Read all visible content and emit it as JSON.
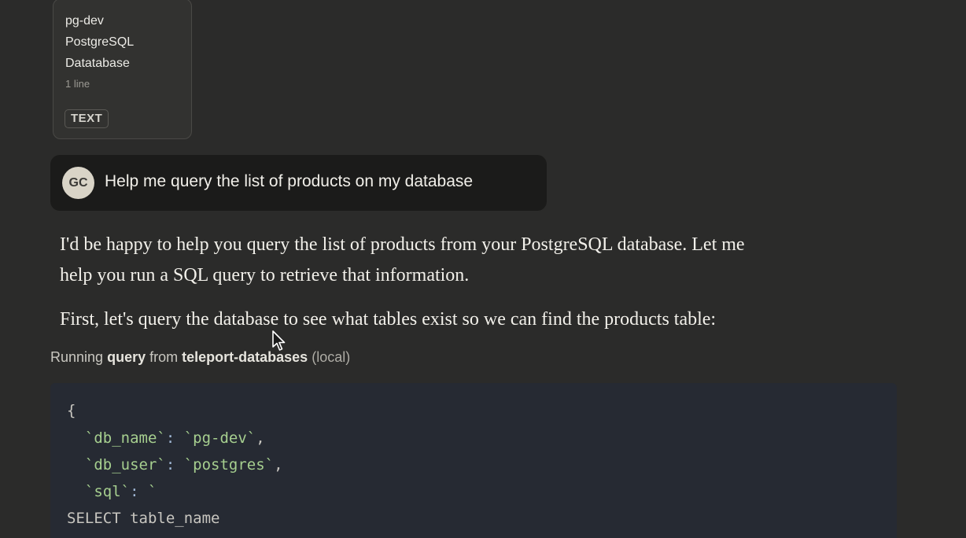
{
  "attachment": {
    "title_lines": [
      "pg-dev",
      "PostgreSQL",
      "Datatabase"
    ],
    "meta": "1 line",
    "badge": "TEXT"
  },
  "user_message": {
    "avatar_initials": "GC",
    "text": "Help me query the list of products on my database"
  },
  "assistant": {
    "paragraph_1_line_1": "I'd be happy to help you query the list of products from your PostgreSQL database. Let me",
    "paragraph_1_line_2": "help you run a SQL query to retrieve that information.",
    "paragraph_2": "First, let's query the database to see what tables exist so we can find the products table:"
  },
  "tool_call": {
    "prefix": "Running",
    "tool_name": "query",
    "from": "from",
    "server": "teleport-databases",
    "scope": "(local)"
  },
  "code": {
    "line_1": "{",
    "line_2_key": "`db_name`",
    "line_2_sep": ": ",
    "line_2_val": "`pg-dev`",
    "line_2_end": ",",
    "line_3_key": "`db_user`",
    "line_3_sep": ": ",
    "line_3_val": "`postgres`",
    "line_3_end": ",",
    "line_4_key": "`sql`",
    "line_4_sep": ": ",
    "line_4_val": "`",
    "line_5": "SELECT table_name"
  },
  "icons": {
    "cursor": "mouse-pointer-icon"
  }
}
